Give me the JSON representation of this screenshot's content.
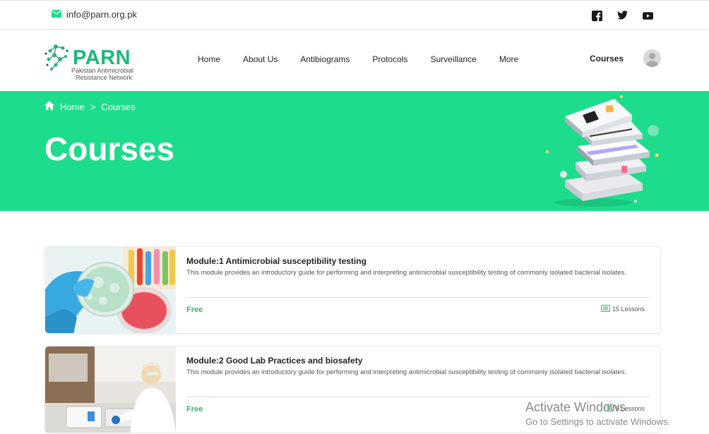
{
  "topbar": {
    "email": "info@parn.org.pk",
    "social": [
      "facebook-icon",
      "twitter-icon",
      "youtube-icon"
    ]
  },
  "header": {
    "logo": {
      "word": "PARN",
      "line1": "Pakistan Antimicrobial",
      "line2": "Resistance Network"
    },
    "nav": [
      "Home",
      "About Us",
      "Antibiograms",
      "Protocols",
      "Surveillance",
      "More"
    ],
    "courses_label": "Courses"
  },
  "hero": {
    "breadcrumb": {
      "home": "Home",
      "separator": ">",
      "current": "Courses"
    },
    "title": "Courses",
    "bg_color": "#1ddc8b"
  },
  "courses": [
    {
      "title": "Module:1 Antimicrobial susceptibility testing",
      "description": "This module provides an introductory guide for performing and interpreting antimicrobial susceptibility testing of commonly isolated bacterial isolates.",
      "price": "Free",
      "lessons": "15 Lessons"
    },
    {
      "title": "Module:2 Good Lab Practices and biosafety",
      "description": "This module provides an introductory guide for performing and interpreting antimicrobial susceptibility testing of commonly isolated bacterial isolates.",
      "price": "Free",
      "lessons": "9 Lessons"
    }
  ],
  "watermark": {
    "line1": "Activate Windows",
    "line2": "Go to Settings to activate Windows."
  }
}
